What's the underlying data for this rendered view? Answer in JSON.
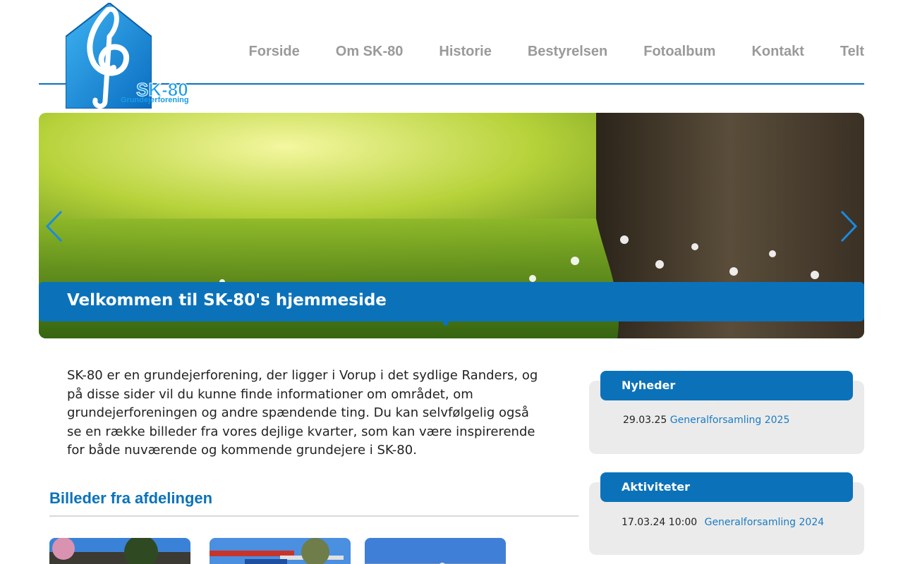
{
  "logo": {
    "name": "SK-80",
    "subtitle": "Grundejerforening",
    "icon": "treble-clef-house-icon"
  },
  "nav": {
    "items": [
      "Forside",
      "Om SK-80",
      "Historie",
      "Bestyrelsen",
      "Fotoalbum",
      "Kontakt",
      "Telt"
    ]
  },
  "slider": {
    "caption": "Velkommen til SK-80's hjemmeside",
    "prev_icon": "chevron-left-icon",
    "next_icon": "chevron-right-icon"
  },
  "intro": {
    "text": "SK-80 er en grundejerforening, der ligger i Vorup i det sydlige Randers, og på disse sider vil du kunne finde informationer om området, om grundejerforeningen og andre spændende ting. Du kan selvfølgelig også se en række billeder fra vores dejlige kvarter, som kan være inspirerende for både nuværende og kommende grundejere i SK-80."
  },
  "gallery": {
    "title": "Billeder fra afdelingen"
  },
  "news": {
    "title": "Nyheder",
    "items": [
      {
        "date": "29.03.25",
        "title": "Generalforsamling 2025"
      }
    ]
  },
  "activities": {
    "title": "Aktiviteter",
    "items": [
      {
        "date": "17.03.24 10:00",
        "title": "Generalforsamling 2024"
      }
    ]
  },
  "colors": {
    "accent": "#0b72ba",
    "nav_text": "#9a9a9a",
    "sidebar_bg": "#ebebeb"
  }
}
